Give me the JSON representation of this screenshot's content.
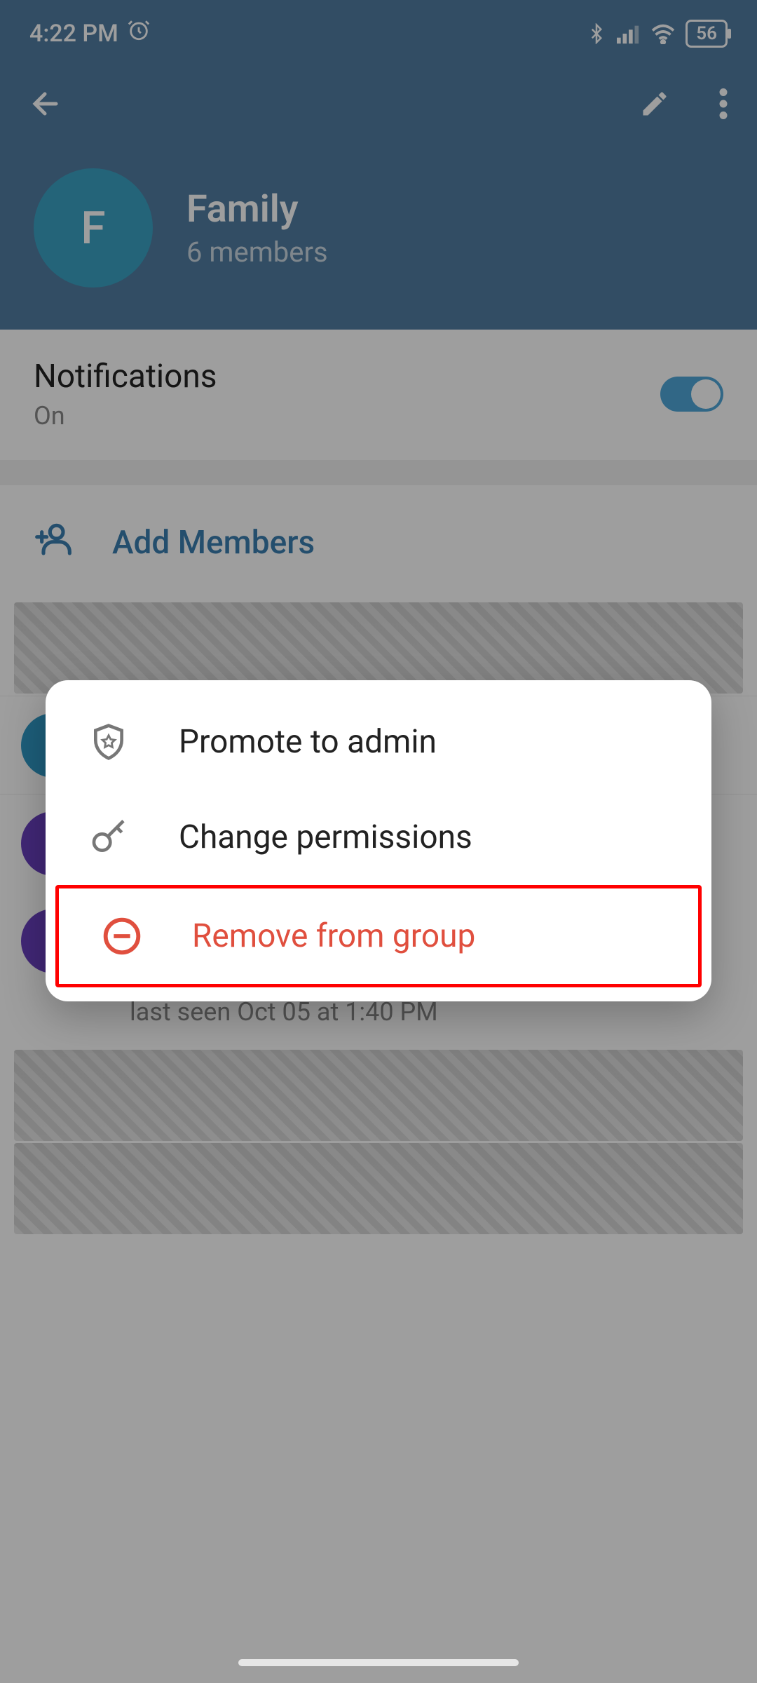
{
  "status_bar": {
    "time": "4:22 PM",
    "battery": "56"
  },
  "header": {
    "title": "Family",
    "subtitle": "6 members",
    "avatar_letter": "F"
  },
  "notifications": {
    "label": "Notifications",
    "state": "On"
  },
  "add_members": {
    "label": "Add Members"
  },
  "member_hint": {
    "last_seen": "last seen Oct 05 at 1:40 PM"
  },
  "popup": {
    "promote": "Promote to admin",
    "permissions": "Change permissions",
    "remove": "Remove from group"
  }
}
